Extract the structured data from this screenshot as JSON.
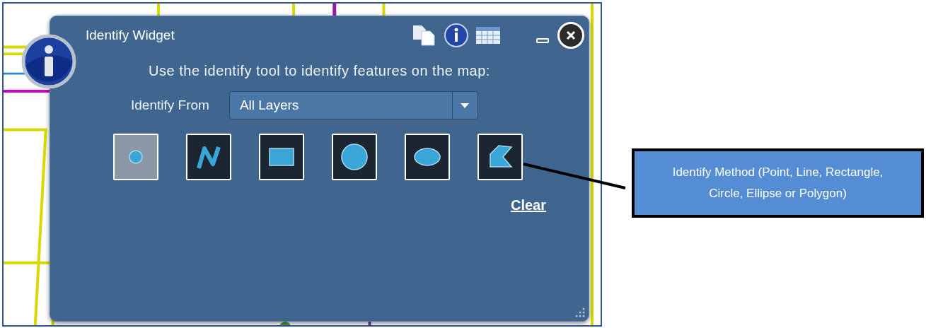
{
  "widget": {
    "title": "Identify Widget",
    "instructions": "Use the identify tool to identify features on the map:",
    "identify_from": {
      "label": "Identify From",
      "value": "All Layers"
    },
    "methods": [
      {
        "kind": "point",
        "selected": true
      },
      {
        "kind": "line",
        "selected": false
      },
      {
        "kind": "rectangle",
        "selected": false
      },
      {
        "kind": "circle",
        "selected": false
      },
      {
        "kind": "ellipse",
        "selected": false
      },
      {
        "kind": "polygon",
        "selected": false
      }
    ],
    "clear_link": "Clear"
  },
  "callout": {
    "text": "Identify Method (Point, Line, Rectangle, Circle, Ellipse or Polygon)"
  }
}
